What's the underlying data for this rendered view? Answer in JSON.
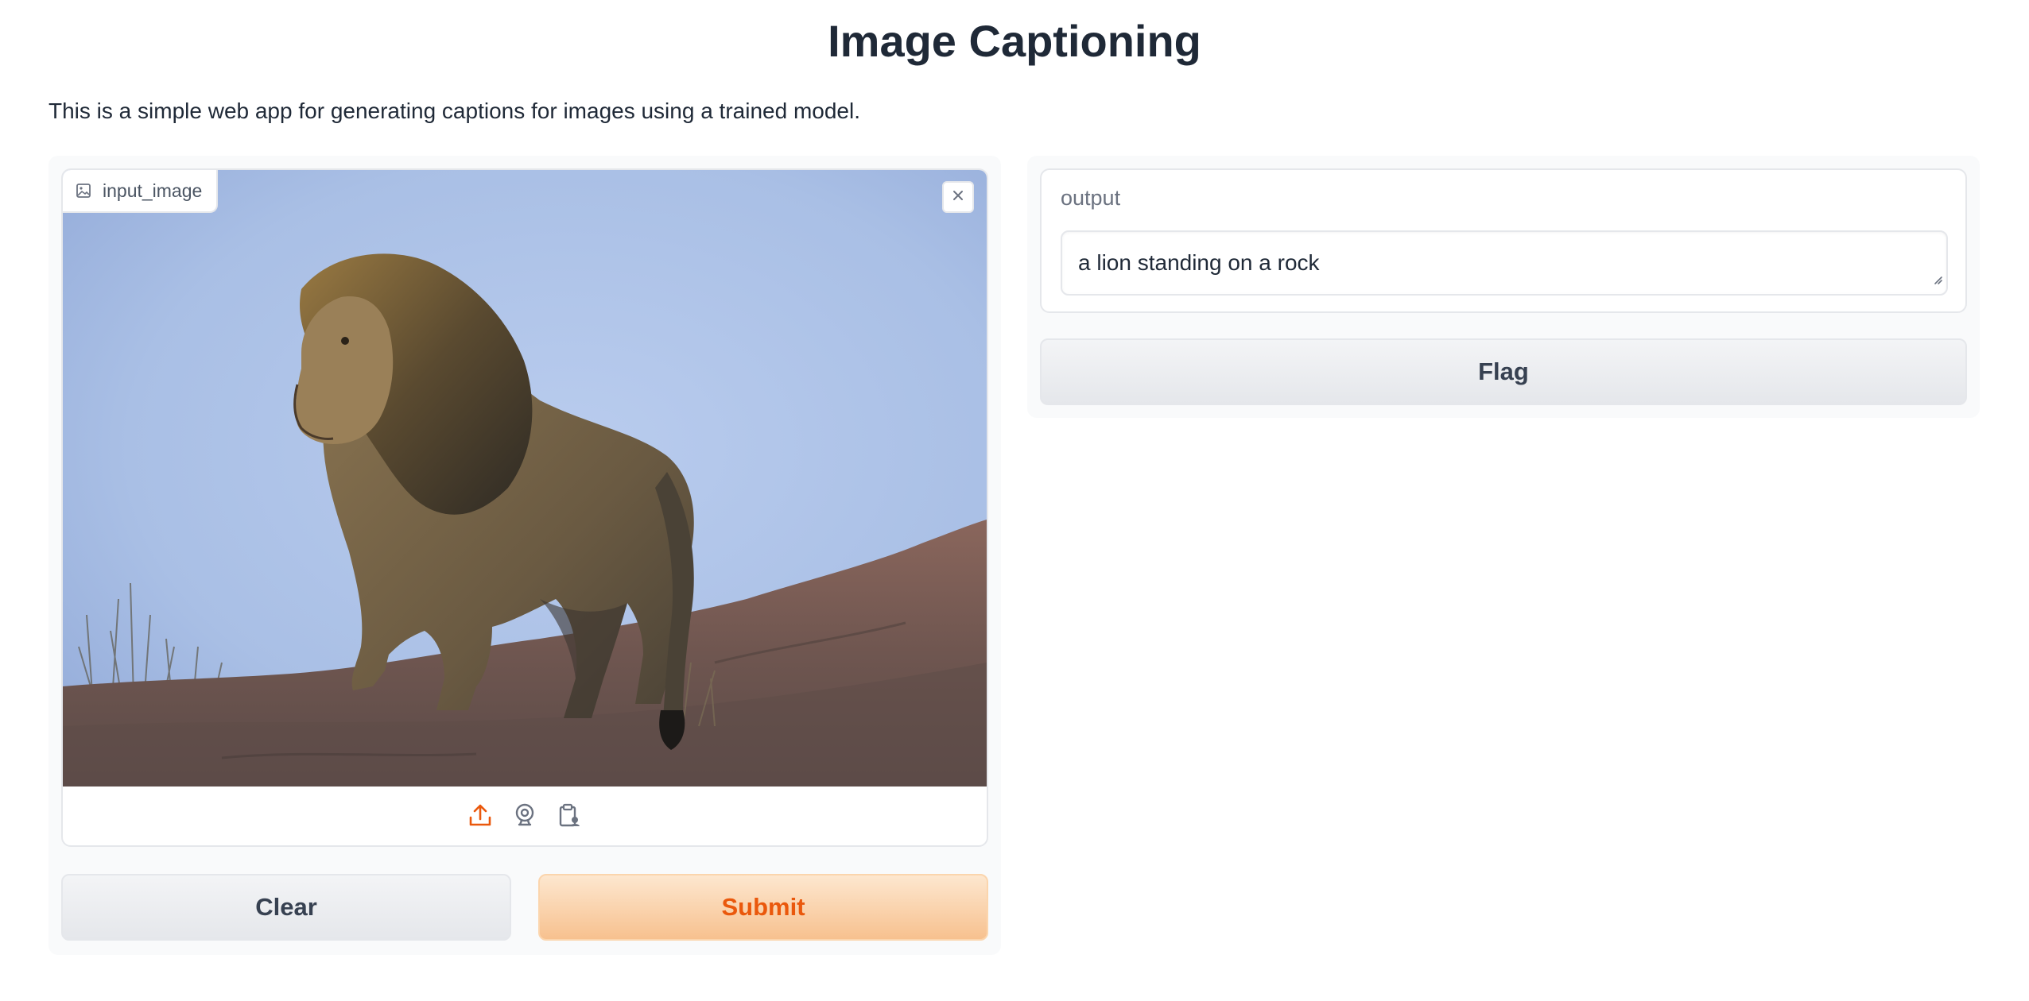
{
  "page": {
    "title": "Image Captioning",
    "description": "This is a simple web app for generating captions for images using a trained model."
  },
  "input": {
    "label": "input_image",
    "label_icon": "image-icon",
    "close_icon": "close-icon",
    "sources": [
      {
        "name": "upload-icon",
        "color": "#ea580c"
      },
      {
        "name": "webcam-icon",
        "color": "#6b7280"
      },
      {
        "name": "clipboard-icon",
        "color": "#6b7280"
      }
    ]
  },
  "buttons": {
    "clear_label": "Clear",
    "submit_label": "Submit",
    "flag_label": "Flag"
  },
  "output": {
    "label": "output",
    "value": "a lion standing on a rock"
  },
  "colors": {
    "accent": "#ea580c",
    "primary_button_top": "#fde7cf",
    "primary_button_bottom": "#f7c18f",
    "secondary_button": "#e5e7eb",
    "panel_bg": "#f9fafb"
  }
}
